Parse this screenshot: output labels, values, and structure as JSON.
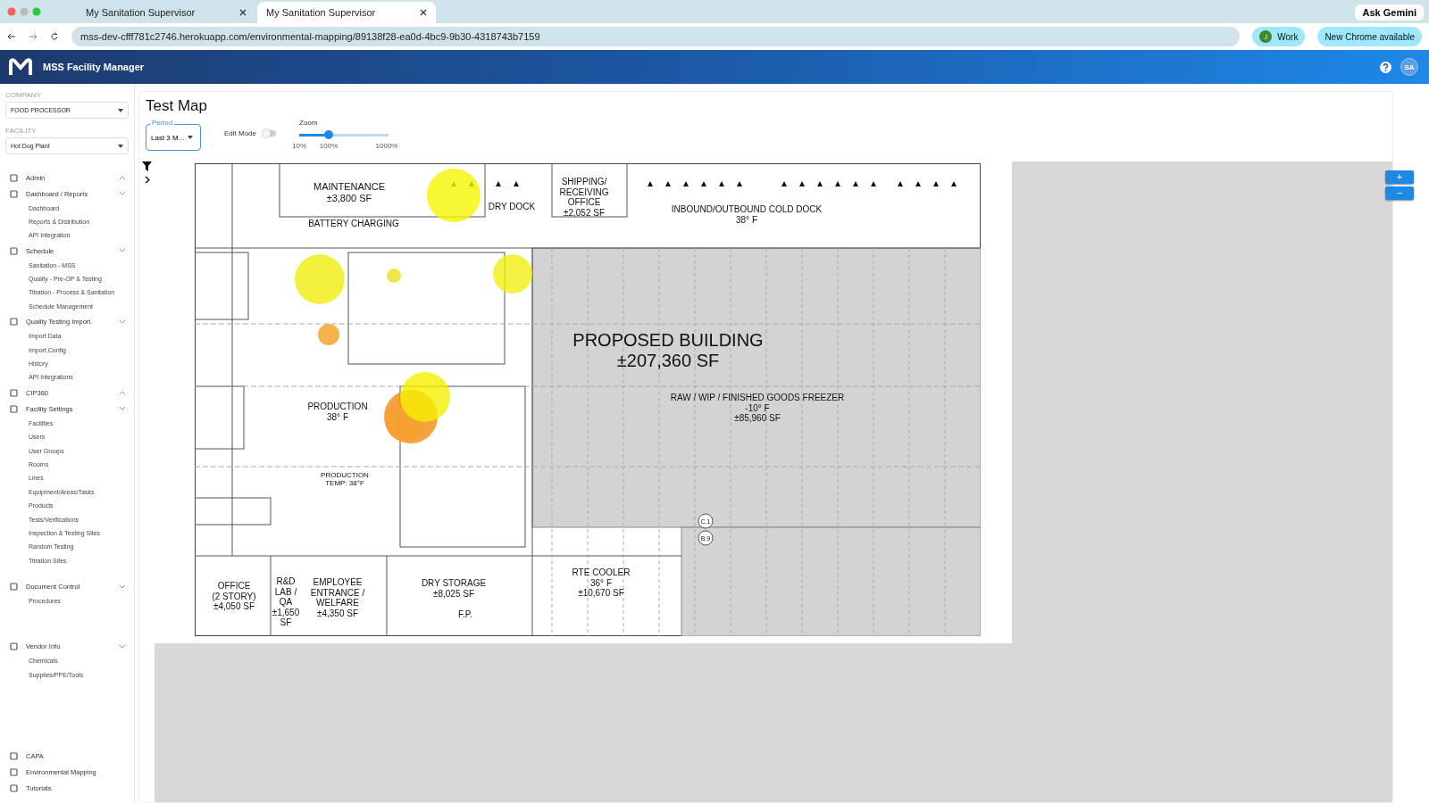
{
  "browser": {
    "tabs": [
      {
        "title": "My Sanitation Supervisor",
        "selected": false
      },
      {
        "title": "My Sanitation Supervisor",
        "selected": true
      }
    ],
    "ask": "Ask Gemini",
    "url": "mss-dev-cfff781c2746.herokuapp.com/environmental-mapping/89138f28-ea0d-4bc9-9b30-4318743b7159",
    "profile": "Work",
    "profile_initial": "J",
    "update": "New Chrome available"
  },
  "app": {
    "title": "MSS Facility Manager",
    "avatar": "SA"
  },
  "sidebar": {
    "company_label": "COMPANY",
    "company": "FOOD PROCESSOR",
    "facility_label": "FACILITY",
    "facility": "Hot Dog Plant",
    "items": [
      {
        "label": "Admin",
        "expanded": true
      },
      {
        "label": "Dashboard / Reports",
        "expanded": false,
        "children": [
          {
            "label": "Dashboard"
          },
          {
            "label": "Reports & Distribution"
          },
          {
            "label": "API Integration"
          }
        ]
      },
      {
        "label": "Schedule",
        "expanded": false,
        "children": [
          {
            "label": "Sanitation - MSS"
          },
          {
            "label": "Quality - Pre-OP & Testing"
          },
          {
            "label": "Titration - Process & Sanitation"
          },
          {
            "label": "Schedule Management"
          }
        ]
      },
      {
        "label": "Quality Testing Import",
        "expanded": false,
        "children": [
          {
            "label": "Import Data"
          },
          {
            "label": "Import Config"
          },
          {
            "label": "History"
          },
          {
            "label": "API Integrations"
          }
        ]
      },
      {
        "label": "CIP360",
        "expanded": true
      },
      {
        "label": "Facility Settings",
        "expanded": false,
        "children": [
          {
            "label": "Facilities"
          },
          {
            "label": "Users"
          },
          {
            "label": "User Groups"
          },
          {
            "label": "Rooms"
          },
          {
            "label": "Lines"
          },
          {
            "label": "Equipment/Areas/Tasks"
          },
          {
            "label": "Products"
          },
          {
            "label": "Tests/Verifications"
          },
          {
            "label": "Inspection & Testing Sites"
          },
          {
            "label": "Random Testing"
          },
          {
            "label": "Titration Sites"
          }
        ]
      },
      {
        "label": "Document Control",
        "expanded": false,
        "children": [
          {
            "label": "Procedures"
          }
        ]
      },
      {
        "label": "Vendor Info",
        "expanded": false,
        "children": [
          {
            "label": "Chemicals"
          },
          {
            "label": "Supplies/PPE/Tools"
          }
        ]
      }
    ],
    "bottom": [
      {
        "label": "CAPA"
      },
      {
        "label": "Environmental Mapping"
      },
      {
        "label": "Tutorials"
      }
    ]
  },
  "page": {
    "title": "Test Map",
    "period_label": "Period",
    "period": "Last 3 M...",
    "edit_mode": "Edit Mode",
    "edit_on": false,
    "zoom_label": "Zoom",
    "zoom": {
      "level": 0.33
    },
    "zoom_ticks": [
      "10%",
      "100%",
      "1000%"
    ],
    "zoom_in": "+",
    "zoom_out": "−"
  },
  "map": {
    "rooms": [
      {
        "lines": [
          "MAINTENANCE",
          "±3,800 SF"
        ]
      },
      {
        "lines": [
          "BATTERY CHARGING"
        ]
      },
      {
        "lines": [
          "DRY DOCK"
        ]
      },
      {
        "lines": [
          "SHIPPING/",
          "RECEIVING",
          "OFFICE",
          "±2,052 SF"
        ]
      },
      {
        "lines": [
          "INBOUND/OUTBOUND COLD DOCK",
          "38° F"
        ]
      },
      {
        "lines": [
          "PROPOSED BUILDING",
          "±207,360 SF"
        ]
      },
      {
        "lines": [
          "PRODUCTION",
          "38° F"
        ]
      },
      {
        "lines": [
          "RAW / WIP / FINISHED GOODS FREEZER",
          "-10° F",
          "±85,960 SF"
        ]
      },
      {
        "lines": [
          "PRODUCTION",
          "TEMP: 38°F"
        ]
      },
      {
        "lines": [
          "OFFICE",
          "(2 STORY)",
          "±4,050 SF"
        ]
      },
      {
        "lines": [
          "R&D",
          "LAB /",
          "QA",
          "±1,650",
          "SF"
        ]
      },
      {
        "lines": [
          "EMPLOYEE",
          "ENTRANCE /",
          "WELFARE",
          "±4,350 SF"
        ]
      },
      {
        "lines": [
          "DRY STORAGE",
          "±8,025 SF"
        ]
      },
      {
        "lines": [
          "F.P."
        ]
      },
      {
        "lines": [
          "RTE COOLER",
          "36° F",
          "±10,670 SF"
        ]
      }
    ],
    "grid_marks": [
      "C.1",
      "B.9"
    ]
  }
}
